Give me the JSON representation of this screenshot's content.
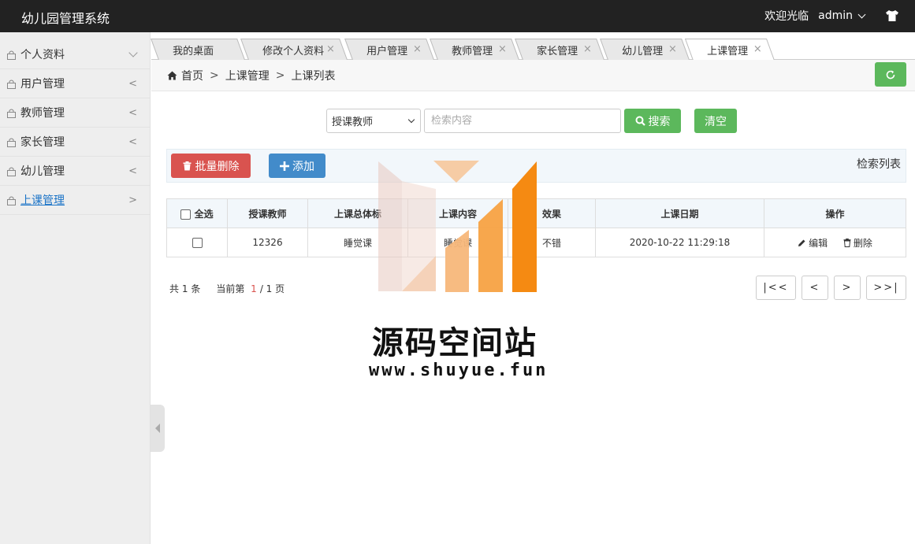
{
  "header": {
    "app_title": "幼儿园管理系统",
    "welcome": "欢迎光临",
    "user": "admin"
  },
  "sidebar": {
    "items": [
      {
        "label": "个人资料",
        "arrow": "expand"
      },
      {
        "label": "用户管理",
        "arrow": "<"
      },
      {
        "label": "教师管理",
        "arrow": "<"
      },
      {
        "label": "家长管理",
        "arrow": "<"
      },
      {
        "label": "幼儿管理",
        "arrow": "<"
      },
      {
        "label": "上课管理",
        "arrow": ">"
      }
    ]
  },
  "tabs": [
    {
      "label": "我的桌面"
    },
    {
      "label": "修改个人资料",
      "close": "×"
    },
    {
      "label": "用户管理",
      "close": "×"
    },
    {
      "label": "教师管理",
      "close": "×"
    },
    {
      "label": "家长管理",
      "close": "×"
    },
    {
      "label": "幼儿管理",
      "close": "×"
    },
    {
      "label": "上课管理",
      "close": "×"
    }
  ],
  "breadcrumb": {
    "home": "首页",
    "sep": ">",
    "level1": "上课管理",
    "level2": "上课列表"
  },
  "search": {
    "field_selected": "授课教师",
    "placeholder": "检索内容",
    "search_label": "搜索",
    "clear_label": "清空"
  },
  "toolbar": {
    "batch_delete_label": "批量删除",
    "add_label": "添加",
    "list_label": "检索列表"
  },
  "table": {
    "select_all_label": "全选",
    "columns": [
      "授课教师",
      "上课总体标",
      "上课内容",
      "效果",
      "上课日期",
      "操作"
    ],
    "rows": [
      {
        "teacher": "12326",
        "standard": "睡觉课",
        "content": "睡觉课",
        "effect": "不错",
        "date": "2020-10-22 11:29:18",
        "edit": "编辑",
        "delete": "删除"
      }
    ]
  },
  "pager": {
    "total_prefix": "共",
    "total": "1",
    "total_suffix": "条",
    "current_prefix": "当前第",
    "current": "1",
    "pages": "/ 1",
    "pages_suffix": "页",
    "first": "|<<",
    "prev": "<",
    "next": ">",
    "last": ">>|"
  },
  "watermark": {
    "title": "源码空间站",
    "url": "www.shuyue.fun"
  },
  "colors": {
    "header_bg": "#222222",
    "green": "#5cb85c",
    "red": "#d9534f",
    "blue": "#428bca",
    "active_link": "#1a73c7"
  }
}
